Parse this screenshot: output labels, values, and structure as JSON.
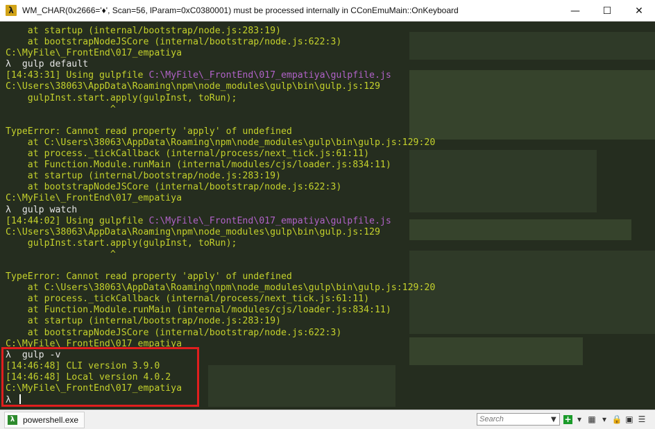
{
  "window": {
    "title": "WM_CHAR(0x2666='♦', Scan=56, lParam=0xC0380001) must be processed internally in CConEmuMain::OnKeyboard",
    "minimize_label": "—",
    "maximize_label": "☐",
    "close_label": "✕"
  },
  "terminal": {
    "lines": [
      [
        {
          "t": "    at startup (internal/bootstrap/node.js:283:19)",
          "c": "y"
        }
      ],
      [
        {
          "t": "    at bootstrapNodeJSCore (internal/bootstrap/node.js:622:3)",
          "c": "y"
        }
      ],
      [
        {
          "t": "C:\\MyFile\\_FrontEnd\\017_empatiya",
          "c": "y"
        }
      ],
      [
        {
          "t": "λ ",
          "c": "w"
        },
        {
          "t": " gulp default",
          "c": "w"
        }
      ],
      [
        {
          "t": "[14:43:31] Using gulpfile ",
          "c": "y"
        },
        {
          "t": "C:\\MyFile\\_FrontEnd\\017_empatiya\\gulpfile.js",
          "c": "p"
        }
      ],
      [
        {
          "t": "C:\\Users\\38063\\AppData\\Roaming\\npm\\node_modules\\gulp\\bin\\gulp.js:129",
          "c": "y"
        }
      ],
      [
        {
          "t": "    gulpInst.start.apply(gulpInst, toRun);",
          "c": "y"
        }
      ],
      [
        {
          "t": "                   ^",
          "c": "y"
        }
      ],
      [
        {
          "t": "",
          "c": "y"
        }
      ],
      [
        {
          "t": "TypeError: Cannot read property 'apply' of undefined",
          "c": "y"
        }
      ],
      [
        {
          "t": "    at C:\\Users\\38063\\AppData\\Roaming\\npm\\node_modules\\gulp\\bin\\gulp.js:129:20",
          "c": "y"
        }
      ],
      [
        {
          "t": "    at process._tickCallback (internal/process/next_tick.js:61:11)",
          "c": "y"
        }
      ],
      [
        {
          "t": "    at Function.Module.runMain (internal/modules/cjs/loader.js:834:11)",
          "c": "y"
        }
      ],
      [
        {
          "t": "    at startup (internal/bootstrap/node.js:283:19)",
          "c": "y"
        }
      ],
      [
        {
          "t": "    at bootstrapNodeJSCore (internal/bootstrap/node.js:622:3)",
          "c": "y"
        }
      ],
      [
        {
          "t": "C:\\MyFile\\_FrontEnd\\017_empatiya",
          "c": "y"
        }
      ],
      [
        {
          "t": "λ ",
          "c": "w"
        },
        {
          "t": " gulp watch",
          "c": "w"
        }
      ],
      [
        {
          "t": "[14:44:02] Using gulpfile ",
          "c": "y"
        },
        {
          "t": "C:\\MyFile\\_FrontEnd\\017_empatiya\\gulpfile.js",
          "c": "p"
        }
      ],
      [
        {
          "t": "C:\\Users\\38063\\AppData\\Roaming\\npm\\node_modules\\gulp\\bin\\gulp.js:129",
          "c": "y"
        }
      ],
      [
        {
          "t": "    gulpInst.start.apply(gulpInst, toRun);",
          "c": "y"
        }
      ],
      [
        {
          "t": "                   ^",
          "c": "y"
        }
      ],
      [
        {
          "t": "",
          "c": "y"
        }
      ],
      [
        {
          "t": "TypeError: Cannot read property 'apply' of undefined",
          "c": "y"
        }
      ],
      [
        {
          "t": "    at C:\\Users\\38063\\AppData\\Roaming\\npm\\node_modules\\gulp\\bin\\gulp.js:129:20",
          "c": "y"
        }
      ],
      [
        {
          "t": "    at process._tickCallback (internal/process/next_tick.js:61:11)",
          "c": "y"
        }
      ],
      [
        {
          "t": "    at Function.Module.runMain (internal/modules/cjs/loader.js:834:11)",
          "c": "y"
        }
      ],
      [
        {
          "t": "    at startup (internal/bootstrap/node.js:283:19)",
          "c": "y"
        }
      ],
      [
        {
          "t": "    at bootstrapNodeJSCore (internal/bootstrap/node.js:622:3)",
          "c": "y"
        }
      ],
      [
        {
          "t": "C:\\MyFile\\_FrontEnd\\017_empatiya",
          "c": "y"
        }
      ],
      [
        {
          "t": "λ ",
          "c": "w"
        },
        {
          "t": " gulp -v",
          "c": "w"
        }
      ],
      [
        {
          "t": "[14:46:48] CLI version 3.9.0",
          "c": "y"
        }
      ],
      [
        {
          "t": "[14:46:48] Local version 4.0.2",
          "c": "y"
        }
      ],
      [
        {
          "t": "C:\\MyFile\\_FrontEnd\\017_empatiya",
          "c": "y"
        }
      ],
      [
        {
          "t": "λ ",
          "c": "w"
        },
        {
          "t": "",
          "c": "cursor"
        }
      ]
    ]
  },
  "colors": {
    "yellow": "#c4d12c",
    "white": "#e5e5e5",
    "purple": "#b062c7",
    "highlight": "#e01e1e"
  },
  "statusbar": {
    "tab_label": "powershell.exe",
    "search_placeholder": "Search",
    "icons": [
      "search-icon",
      "add-icon",
      "dropdown-icon",
      "layout-icon",
      "dropdown-icon",
      "lock-icon",
      "panel-icon",
      "menu-icon"
    ]
  }
}
